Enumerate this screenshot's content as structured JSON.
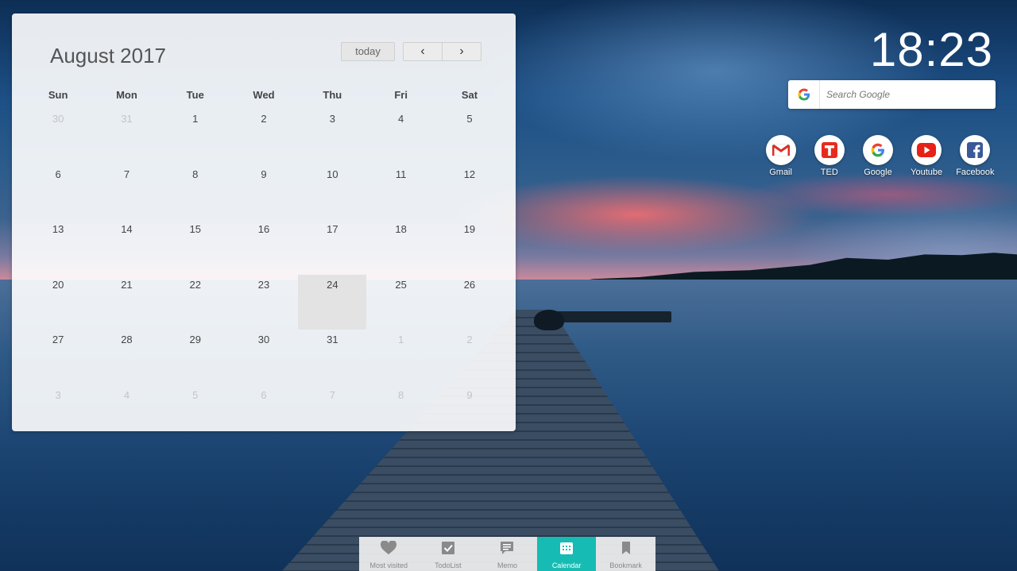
{
  "calendar": {
    "title": "August 2017",
    "today_label": "today",
    "prev_label": "‹",
    "next_label": "›",
    "weekdays": [
      "Sun",
      "Mon",
      "Tue",
      "Wed",
      "Thu",
      "Fri",
      "Sat"
    ],
    "days": [
      {
        "d": "30",
        "other": true
      },
      {
        "d": "31",
        "other": true
      },
      {
        "d": "1"
      },
      {
        "d": "2"
      },
      {
        "d": "3"
      },
      {
        "d": "4"
      },
      {
        "d": "5"
      },
      {
        "d": "6"
      },
      {
        "d": "7"
      },
      {
        "d": "8"
      },
      {
        "d": "9"
      },
      {
        "d": "10"
      },
      {
        "d": "11"
      },
      {
        "d": "12"
      },
      {
        "d": "13"
      },
      {
        "d": "14"
      },
      {
        "d": "15"
      },
      {
        "d": "16"
      },
      {
        "d": "17"
      },
      {
        "d": "18"
      },
      {
        "d": "19"
      },
      {
        "d": "20"
      },
      {
        "d": "21"
      },
      {
        "d": "22"
      },
      {
        "d": "23"
      },
      {
        "d": "24",
        "today": true
      },
      {
        "d": "25"
      },
      {
        "d": "26"
      },
      {
        "d": "27"
      },
      {
        "d": "28"
      },
      {
        "d": "29"
      },
      {
        "d": "30"
      },
      {
        "d": "31"
      },
      {
        "d": "1",
        "other": true
      },
      {
        "d": "2",
        "other": true
      },
      {
        "d": "3",
        "other": true
      },
      {
        "d": "4",
        "other": true
      },
      {
        "d": "5",
        "other": true
      },
      {
        "d": "6",
        "other": true
      },
      {
        "d": "7",
        "other": true
      },
      {
        "d": "8",
        "other": true
      },
      {
        "d": "9",
        "other": true
      }
    ]
  },
  "clock": {
    "time": "18:23"
  },
  "search": {
    "placeholder": "Search Google"
  },
  "shortcuts": [
    {
      "label": "Gmail",
      "icon": "gmail-icon",
      "color": "#d93025"
    },
    {
      "label": "TED",
      "icon": "ted-icon",
      "color": "#e62b1e"
    },
    {
      "label": "Google",
      "icon": "google-icon",
      "color": "#4285f4"
    },
    {
      "label": "Youtube",
      "icon": "youtube-icon",
      "color": "#e62117"
    },
    {
      "label": "Facebook",
      "icon": "facebook-icon",
      "color": "#3b5998"
    }
  ],
  "tabs": [
    {
      "label": "Most visited",
      "icon": "heart-icon",
      "active": false
    },
    {
      "label": "TodoList",
      "icon": "checkbox-icon",
      "active": false
    },
    {
      "label": "Memo",
      "icon": "memo-icon",
      "active": false
    },
    {
      "label": "Calendar",
      "icon": "calendar-icon",
      "active": true
    },
    {
      "label": "Bookmark",
      "icon": "bookmark-icon",
      "active": false
    }
  ],
  "colors": {
    "accent": "#16bcb4",
    "today_highlight": "#e3e3e3"
  }
}
